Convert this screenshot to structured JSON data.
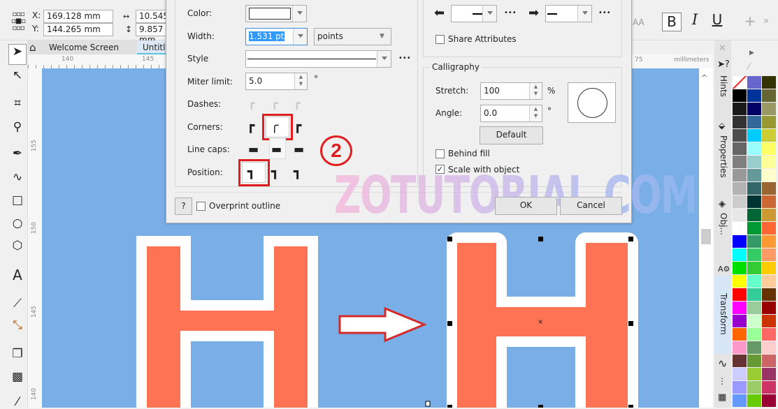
{
  "property_bar": {
    "x_label": "X:",
    "x_value": "169.128 mm",
    "y_label": "Y:",
    "y_value": "144.265 mm",
    "width_value": "10.545",
    "height_value": "9.857 mm",
    "text_buttons": {
      "bold": "B",
      "italic": "I",
      "underline": "U",
      "add": "+",
      "more": "»",
      "aa": "AA"
    }
  },
  "tabs": [
    {
      "label": "Welcome Screen"
    },
    {
      "label": "Untitl"
    }
  ],
  "ruler": {
    "h_labels": [
      "140",
      "145",
      "75"
    ],
    "unit": "millimeters",
    "v_labels": [
      "155",
      "150",
      "145",
      "140"
    ]
  },
  "dialog": {
    "color_label": "Color:",
    "width_label": "Width:",
    "width_value": "1.531 pt",
    "units_value": "points",
    "style_label": "Style",
    "miter_label": "Miter limit:",
    "miter_value": "5.0",
    "degree": "°",
    "dashes_label": "Dashes:",
    "corners_label": "Corners:",
    "linecaps_label": "Line caps:",
    "position_label": "Position:",
    "share_attributes": "Share Attributes",
    "calligraphy_title": "Calligraphy",
    "stretch_label": "Stretch:",
    "stretch_value": "100",
    "percent": "%",
    "angle_label": "Angle:",
    "angle_value": "0.0",
    "default_button": "Default",
    "behind_fill": "Behind fill",
    "behind_fill_checked": false,
    "scale_with_object": "Scale with object",
    "scale_with_object_checked": true,
    "help_button": "?",
    "overprint_outline": "Overprint outline",
    "overprint_checked": false,
    "ok_button": "OK",
    "cancel_button": "Cancel",
    "more": "•••"
  },
  "annotation": {
    "step_number": "2",
    "highlight_color": "#e02020"
  },
  "watermark": "ZOTUTORIAL.COM",
  "dockers": {
    "hints": "Hints",
    "properties": "Properties",
    "objects": "Obj...",
    "transform": "Transform"
  },
  "canvas": {
    "background": "#7aaee6",
    "letter_fill": "#ff7355",
    "outline": "#ffffff",
    "center_mark": "×"
  },
  "palette": [
    [
      "none",
      "#6666cc",
      "#333300"
    ],
    [
      "#000000",
      "#003399",
      "#666633"
    ],
    [
      "#1a1a1a",
      "#000066",
      "#999966"
    ],
    [
      "#333333",
      "#336699",
      "#999933"
    ],
    [
      "#4d4d4d",
      "#00ccff",
      "#cccc33"
    ],
    [
      "#666666",
      "#99ffff",
      "#ffff66"
    ],
    [
      "#808080",
      "#99cccc",
      "#ffff99"
    ],
    [
      "#999999",
      "#669999",
      "#ffffcc"
    ],
    [
      "#b3b3b3",
      "#336666",
      "#996633"
    ],
    [
      "#cccccc",
      "#003333",
      "#cc6633"
    ],
    [
      "#e6e6e6",
      "#006633",
      "#cc9933"
    ],
    [
      "#ffffff",
      "#009933",
      "#ff6633"
    ],
    [
      "#0000ff",
      "#339966",
      "#ff9933"
    ],
    [
      "#00ffff",
      "#33cc66",
      "#ff9966"
    ],
    [
      "#00e000",
      "#33cc33",
      "#ffcc00"
    ],
    [
      "#ffff00",
      "#66ffcc",
      "#ffcc99"
    ],
    [
      "#ff0000",
      "#33cc99",
      "#663300"
    ],
    [
      "#ff00ff",
      "#99cc99",
      "#990000"
    ],
    [
      "#9900cc",
      "#ccffcc",
      "#cc3300"
    ],
    [
      "#ff6600",
      "#99ff99",
      "#ff6666"
    ],
    [
      "#ff99cc",
      "#669966",
      "#ffcccc"
    ],
    [
      "#663333",
      "#669933",
      "#cc6666"
    ],
    [
      "#ccccff",
      "#99cc33",
      "#993366"
    ],
    [
      "#9999ff",
      "#99cc66",
      "#cc3366"
    ],
    [
      "#6699ff",
      "#66cc00",
      "#990033"
    ]
  ]
}
